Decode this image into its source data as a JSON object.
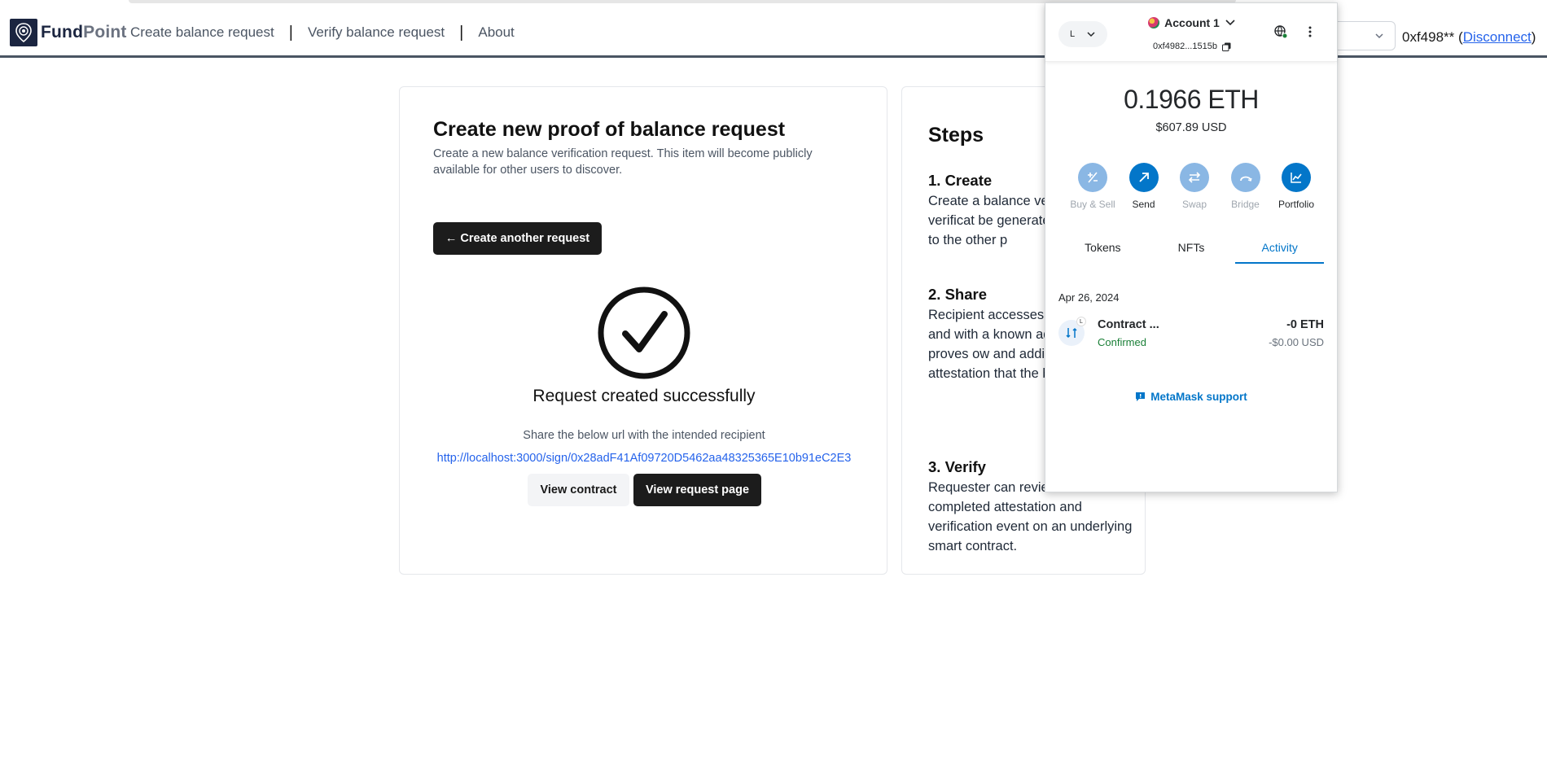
{
  "brand": {
    "name_bold": "Fund",
    "name_light": "Point"
  },
  "nav": {
    "links": [
      "Create balance request",
      "Verify balance request",
      "About"
    ],
    "separator": "|"
  },
  "account": {
    "address": "0xf498**",
    "open_paren": "(",
    "disconnect": "Disconnect",
    "close_paren": ")"
  },
  "main_card": {
    "title": "Create new proof of balance request",
    "description": "Create a new balance verification request. This item will become publicly available for other users to discover.",
    "back_button": "← Create another request",
    "success_title": "Request created successfully",
    "share_text": "Share the below url with the intended recipient",
    "share_url": "http://localhost:3000/sign/0x28adF41Af09720D5462aa48325365E10b91eC2E3",
    "view_contract": "View contract",
    "view_request": "View request page"
  },
  "steps": {
    "title": "Steps",
    "items": [
      {
        "heading": "1. Create",
        "body": "Create a balance ve request. A verificat be generated that y send to the other p"
      },
      {
        "heading": "2. Share",
        "body": "Recipient accesses verification link and with a known addre recipient proves ow and additionally sig attestation that the belong to them."
      },
      {
        "heading": "3. Verify",
        "body": "Requester can review the completed attestation and verification event on an underlying smart contract."
      }
    ]
  },
  "metamask": {
    "network_letter": "L",
    "account_name": "Account 1",
    "account_address": "0xf4982...1515b",
    "balance": "0.1966 ETH",
    "balance_usd": "$607.89 USD",
    "actions": [
      {
        "label": "Buy & Sell",
        "icon": "buy-sell-icon",
        "enabled": false
      },
      {
        "label": "Send",
        "icon": "send-arrow-icon",
        "enabled": true
      },
      {
        "label": "Swap",
        "icon": "swap-icon",
        "enabled": false
      },
      {
        "label": "Bridge",
        "icon": "bridge-icon",
        "enabled": false
      },
      {
        "label": "Portfolio",
        "icon": "chart-line-icon",
        "enabled": true
      }
    ],
    "tabs": [
      "Tokens",
      "NFTs",
      "Activity"
    ],
    "active_tab": "Activity",
    "activity_date": "Apr 26, 2024",
    "transaction": {
      "badge": "L",
      "name": "Contract ...",
      "status": "Confirmed",
      "amount": "-0 ETH",
      "amount_usd": "-$0.00 USD"
    },
    "support": "MetaMask support",
    "colors": {
      "accent": "#0376c9",
      "disabled": "#8ab7e4",
      "confirmed": "#1a7f37"
    }
  }
}
